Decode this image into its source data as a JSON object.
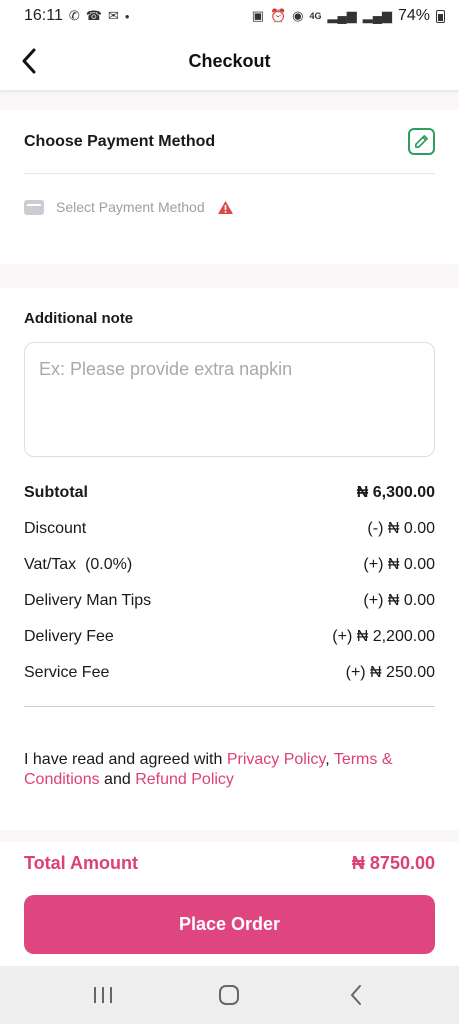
{
  "status_bar": {
    "time": "16:11",
    "network": "4G",
    "battery": "74%"
  },
  "app_bar": {
    "title": "Checkout"
  },
  "payment": {
    "title": "Choose Payment Method",
    "placeholder": "Select Payment Method"
  },
  "note": {
    "title": "Additional note",
    "placeholder": "Ex: Please provide extra napkin"
  },
  "summary": {
    "rows": [
      {
        "label": "Subtotal",
        "value": "₦ 6,300.00"
      },
      {
        "label": "Discount",
        "value": "(-) ₦ 0.00"
      },
      {
        "label": "Vat/Tax  (0.0%)",
        "value": "(+) ₦ 0.00"
      },
      {
        "label": "Delivery Man Tips",
        "value": "(+) ₦ 0.00"
      },
      {
        "label": "Delivery Fee",
        "value": "(+) ₦ 2,200.00"
      },
      {
        "label": "Service Fee",
        "value": "(+) ₦ 250.00"
      }
    ]
  },
  "terms": {
    "prefix": "I have read and agreed with ",
    "privacy": "Privacy Policy",
    "comma": ", ",
    "terms_conditions": "Terms & Conditions",
    "and": " and ",
    "refund": "Refund Policy"
  },
  "total": {
    "label": "Total Amount",
    "value": "₦ 8750.00"
  },
  "place_order": {
    "label": "Place Order"
  },
  "colors": {
    "accent": "#df467f",
    "edit": "#2e9e5e",
    "warning": "#e04848"
  }
}
